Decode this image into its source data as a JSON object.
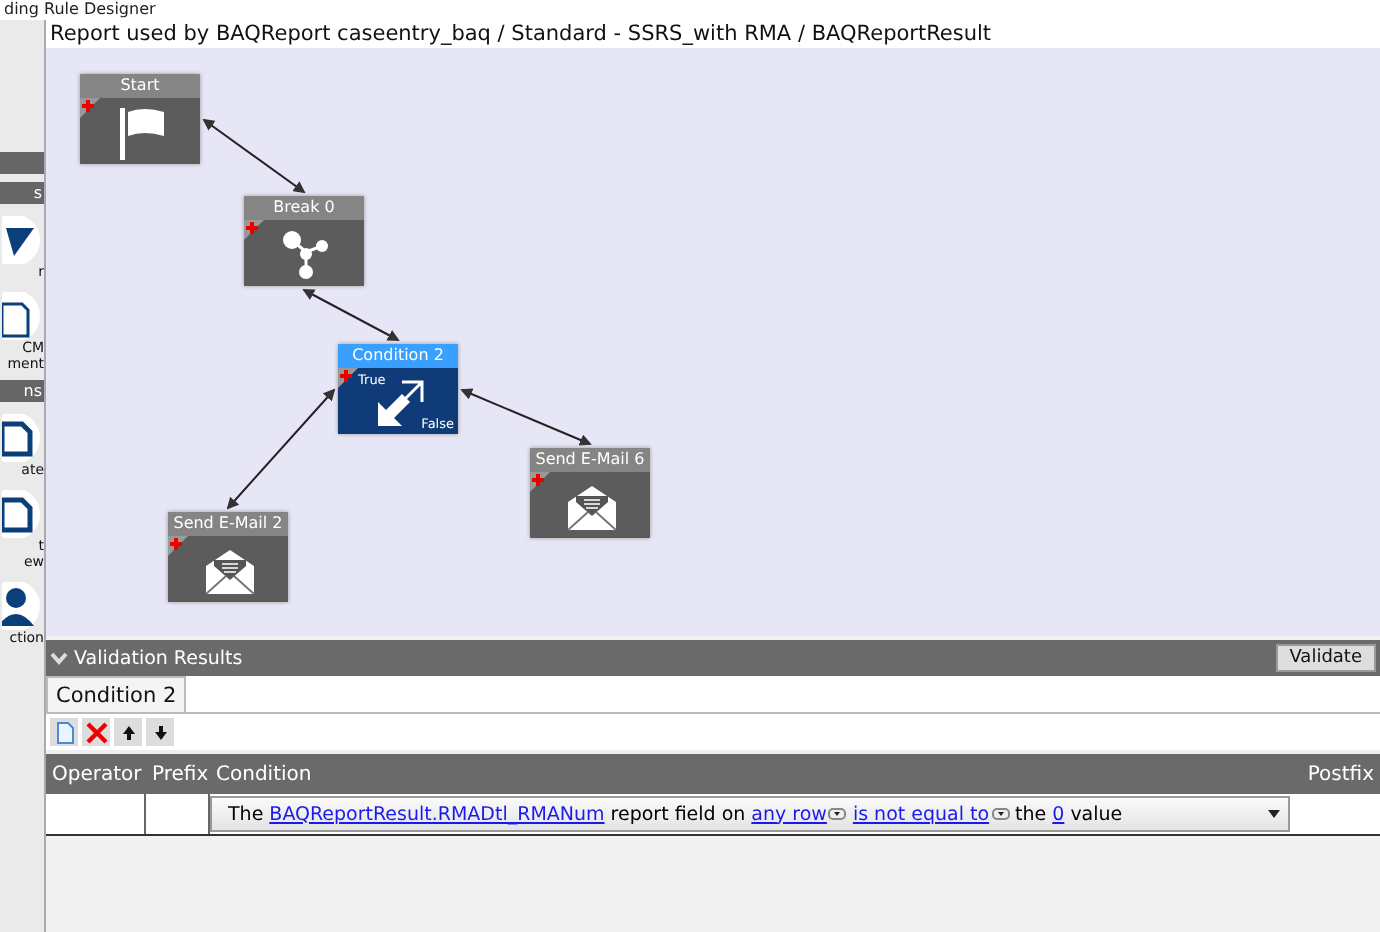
{
  "window": {
    "title": "ding Rule Designer"
  },
  "sidebar": {
    "sections": [
      {
        "title": "s",
        "items": [
          {
            "kind": "triangle",
            "lines": [
              "r"
            ]
          },
          {
            "kind": "document",
            "lines": [
              "CM",
              "ment"
            ]
          }
        ]
      },
      {
        "title": "ns",
        "items": [
          {
            "kind": "page",
            "lines": [
              "ate"
            ]
          },
          {
            "kind": "page",
            "lines": [
              "t",
              "ew"
            ]
          },
          {
            "kind": "person",
            "lines": [
              "ction"
            ]
          }
        ]
      }
    ]
  },
  "breadcrumb": "Report used by BAQReport caseentry_baq / Standard - SSRS_with RMA / BAQReportResult",
  "nodes": [
    {
      "title": "Start",
      "kind": "start",
      "selected": false
    },
    {
      "title": "Break 0",
      "kind": "break",
      "selected": false
    },
    {
      "title": "Condition 2",
      "kind": "condition",
      "selected": true,
      "true_label": "True",
      "false_label": "False"
    },
    {
      "title": "Send E-Mail 2",
      "kind": "email",
      "selected": false
    },
    {
      "title": "Send E-Mail 6",
      "kind": "email",
      "selected": false
    }
  ],
  "validation": {
    "title": "Validation Results",
    "expanded": true,
    "button": "Validate"
  },
  "tabs": [
    {
      "label": "Condition 2",
      "selected": true
    }
  ],
  "toolbar": [
    {
      "kind": "new"
    },
    {
      "kind": "delete"
    },
    {
      "kind": "up"
    },
    {
      "kind": "down"
    }
  ],
  "table": {
    "columns": [
      "Operator",
      "Prefix",
      "Condition",
      "Postfix"
    ],
    "rows": [
      {
        "condition": [
          {
            "kind": "text",
            "text": "The"
          },
          {
            "kind": "link",
            "text": "BAQReportResult.RMADtl_RMANum"
          },
          {
            "kind": "text",
            "text": "report field on"
          },
          {
            "kind": "dropdown",
            "text": "any row"
          },
          {
            "kind": "dropdown",
            "text": "is not equal to"
          },
          {
            "kind": "text",
            "text": "the"
          },
          {
            "kind": "link",
            "text": "0"
          },
          {
            "kind": "text",
            "text": "value"
          }
        ]
      }
    ]
  }
}
